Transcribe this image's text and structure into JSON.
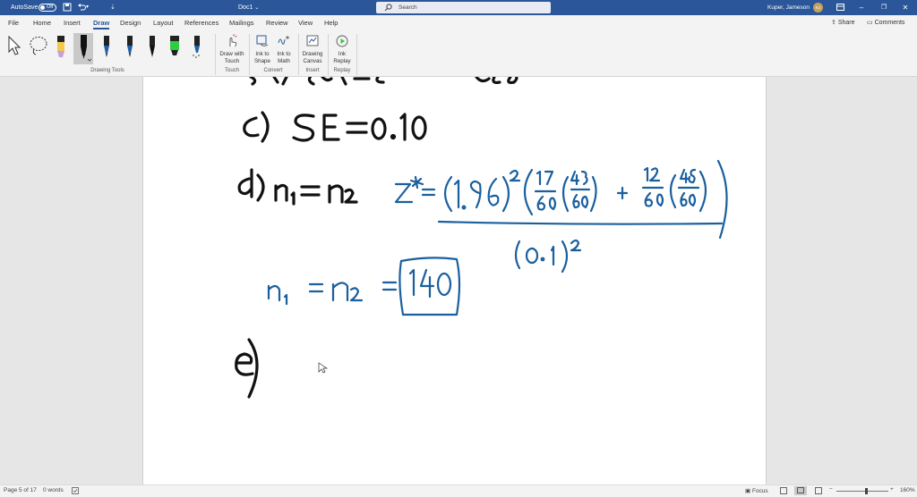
{
  "titlebar": {
    "autosave_label": "AutoSave",
    "autosave_state": "Off",
    "doc_title": "Doc1",
    "doc_title_chevron": "⌄",
    "search_placeholder": "Search",
    "user_name": "Kuper, Jameson",
    "user_initials": "KJ"
  },
  "tabs": [
    {
      "label": "File"
    },
    {
      "label": "Home"
    },
    {
      "label": "Insert"
    },
    {
      "label": "Draw",
      "active": true
    },
    {
      "label": "Design"
    },
    {
      "label": "Layout"
    },
    {
      "label": "References"
    },
    {
      "label": "Mailings"
    },
    {
      "label": "Review"
    },
    {
      "label": "View"
    },
    {
      "label": "Help"
    }
  ],
  "share_label": "Share",
  "comments_label": "Comments",
  "ribbon": {
    "groups": {
      "drawing_tools": "Drawing Tools",
      "touch": "Touch",
      "convert": "Convert",
      "insert": "Insert",
      "replay": "Replay"
    },
    "buttons": {
      "draw_with_touch": [
        "Draw with",
        "Touch"
      ],
      "ink_to_shape": [
        "Ink to",
        "Shape"
      ],
      "ink_to_math": [
        "Ink to",
        "Math"
      ],
      "drawing_canvas": [
        "Drawing",
        "Canvas"
      ],
      "ink_replay": [
        "Ink",
        "Replay"
      ]
    },
    "pen_colors": [
      "#f2c94c",
      "#111111",
      "#1f5fa8",
      "#1f5fa8",
      "#111111",
      "#2ecc40",
      "#1f5fa8"
    ],
    "pen_selected_index": 1
  },
  "document": {
    "ink_color_black": "#111111",
    "ink_color_blue": "#1a5f9e",
    "handwritten": {
      "line_c": "c) SE = 0.10",
      "line_d": "d) n1 = n2",
      "formula": "z* = (1.96)^2 ( 17/60 (43/60) + 12/60 (48/60) ) / (0.1)^2",
      "answer": "n1 = n2 = 140",
      "line_e": "e)"
    }
  },
  "status": {
    "page": "Page 5 of 17",
    "words": "0 words",
    "focus": "Focus",
    "zoom": "160%",
    "zoom_minus": "−",
    "zoom_plus": "+"
  }
}
